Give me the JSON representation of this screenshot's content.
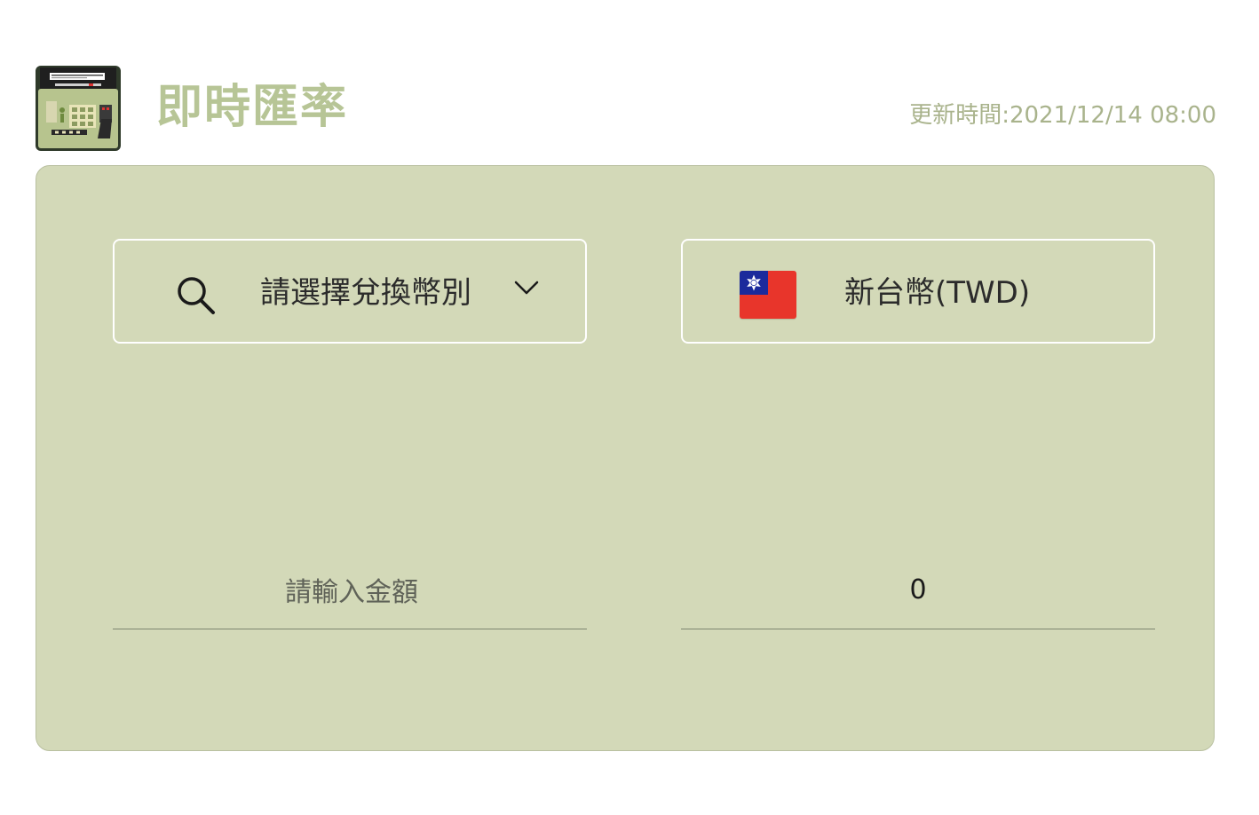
{
  "header": {
    "app_icon": "cash-register-icon",
    "title": "即時匯率",
    "update_time": "更新時間:2021/12/14 08:00"
  },
  "converter": {
    "from_currency": {
      "icon": "search-icon",
      "label": "請選擇兌換幣別",
      "dropdown_icon": "chevron-down-icon"
    },
    "to_currency": {
      "icon": "taiwan-flag-icon",
      "label": "新台幣(TWD)"
    },
    "from_amount": {
      "placeholder": "請輸入金額",
      "value": ""
    },
    "to_amount": {
      "value": "0"
    }
  },
  "colors": {
    "title": "#b7c596",
    "panel_background": "#d3d9b8",
    "update_time": "#a9b38c"
  }
}
